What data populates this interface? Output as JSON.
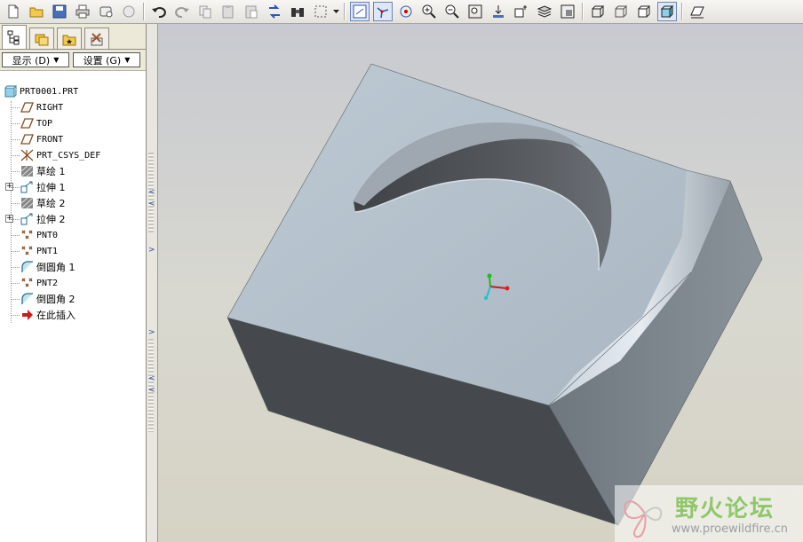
{
  "toolbar": {
    "buttons": [
      "new",
      "open",
      "save",
      "print",
      "email",
      "send",
      "undo",
      "redo",
      "copy",
      "paste",
      "paste-special",
      "regenerate",
      "find",
      "select-box",
      "datum-display",
      "csys-display",
      "spin-center",
      "zoom-in",
      "zoom-out",
      "refit",
      "reorient",
      "saved-views",
      "layers",
      "view-manager",
      "wireframe",
      "hidden-line",
      "no-hidden",
      "shading",
      "sketch-plane"
    ]
  },
  "panel": {
    "tabs": [
      "model-tree",
      "layer-tree",
      "favorites",
      "settings"
    ],
    "show_label": "显示 (D)",
    "settings_label": "设置 (G)",
    "tree": [
      {
        "label": "PRT0001.PRT",
        "icon": "part-icon"
      },
      {
        "label": "RIGHT",
        "icon": "datum-plane-icon"
      },
      {
        "label": "TOP",
        "icon": "datum-plane-icon"
      },
      {
        "label": "FRONT",
        "icon": "datum-plane-icon"
      },
      {
        "label": "PRT_CSYS_DEF",
        "icon": "csys-icon"
      },
      {
        "label": "草绘 1",
        "icon": "sketch-icon"
      },
      {
        "label": "拉伸 1",
        "icon": "extrude-icon"
      },
      {
        "label": "草绘 2",
        "icon": "sketch-icon"
      },
      {
        "label": "拉伸 2",
        "icon": "extrude-icon"
      },
      {
        "label": "PNT0",
        "icon": "datum-point-icon"
      },
      {
        "label": "PNT1",
        "icon": "datum-point-icon"
      },
      {
        "label": "倒圆角 1",
        "icon": "round-icon"
      },
      {
        "label": "PNT2",
        "icon": "datum-point-icon"
      },
      {
        "label": "倒圆角 2",
        "icon": "round-icon"
      },
      {
        "label": "在此插入",
        "icon": "insert-here-icon"
      }
    ]
  },
  "watermark": {
    "text": "野火论坛",
    "url": "www.proewildfire.cn"
  },
  "colors": {
    "top_face": "#b7c3ce",
    "front_face": "#45494e",
    "right_face": "#7c848c",
    "viewport_bg": "#d4d3cb"
  }
}
